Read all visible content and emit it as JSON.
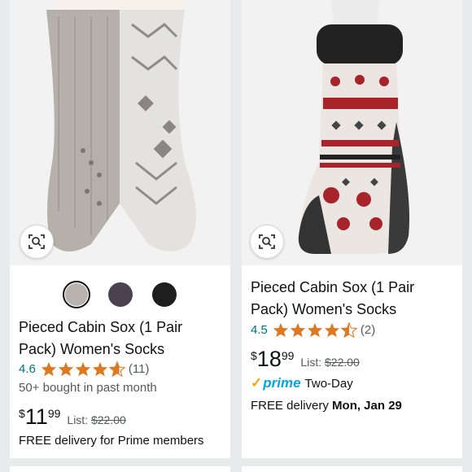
{
  "products": [
    {
      "title": "Pieced Cabin Sox (1 Pair Pack) Women's Socks",
      "rating": "4.6",
      "rating_value": 4.6,
      "review_count": "(11)",
      "bought": "50+ bought in past month",
      "price_symbol": "$",
      "price_whole": "11",
      "price_fraction": "99",
      "list_label": "List:",
      "list_price": "$22.00",
      "delivery": "FREE delivery for Prime members",
      "swatches": [
        "#b9b3b0",
        "#4a4250",
        "#1e1e1e"
      ]
    },
    {
      "title": "Pieced Cabin Sox (1 Pair Pack) Women's Socks",
      "rating": "4.5",
      "rating_value": 4.5,
      "review_count": "(2)",
      "price_symbol": "$",
      "price_whole": "18",
      "price_fraction": "99",
      "list_label": "List:",
      "list_price": "$22.00",
      "prime_label": "prime",
      "prime_shipping": "Two-Day",
      "delivery_prefix": "FREE delivery",
      "delivery_date": "Mon, Jan 29"
    }
  ],
  "icons": {
    "lens": "visual-search-icon",
    "star": "star-icon"
  },
  "colors": {
    "star": "#de7921",
    "link": "#007185",
    "prime": "#00a8e1"
  }
}
